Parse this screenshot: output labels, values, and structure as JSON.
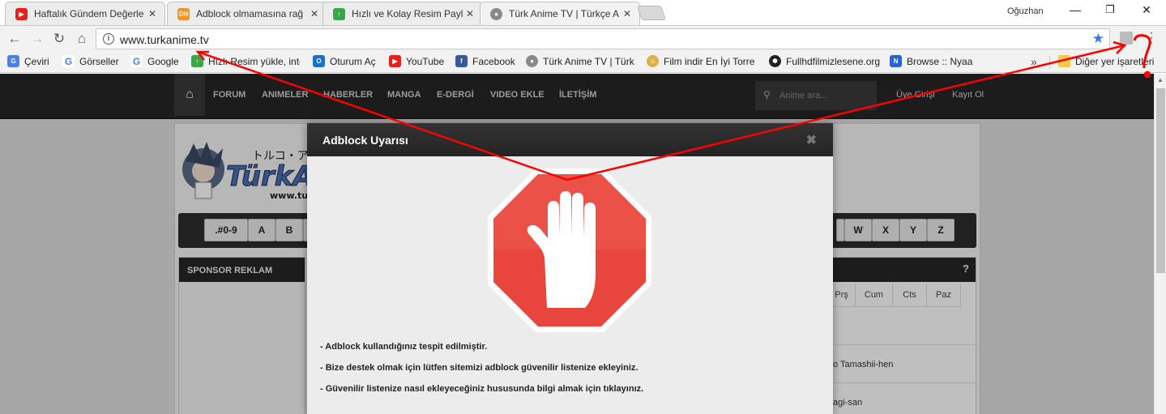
{
  "browser": {
    "tabs": [
      {
        "title": "Haftalık Gündem Değerle",
        "icon": "youtube-icon",
        "color": "#e62117"
      },
      {
        "title": "Adblock olmamasına rağ",
        "icon": "dh-icon",
        "color": "#f3922b"
      },
      {
        "title": "Hızlı ve Kolay Resim Payl",
        "icon": "upload-arrow-icon",
        "color": "#3aa648"
      },
      {
        "title": "Türk Anime TV | Türkçe A",
        "icon": "turkanime-icon",
        "color": "#7a7a7a"
      }
    ],
    "profile": "Oğuzhan",
    "url": "www.turkanime.tv",
    "bookmarks": [
      {
        "label": "Çeviri",
        "icon": "translate-icon"
      },
      {
        "label": "Görseller",
        "icon": "google-icon"
      },
      {
        "label": "Google",
        "icon": "google-icon"
      },
      {
        "label": "Hızlı Resim yükle, inte",
        "icon": "upload-arrow-icon"
      },
      {
        "label": "Oturum Aç",
        "icon": "outlook-icon"
      },
      {
        "label": "YouTube",
        "icon": "youtube-icon"
      },
      {
        "label": "Facebook",
        "icon": "facebook-icon"
      },
      {
        "label": "Türk Anime TV | Türk",
        "icon": "turkanime-icon"
      },
      {
        "label": "Film indir En İyi Torre",
        "icon": "film-icon"
      },
      {
        "label": "Fullhdfilmizlesene.org",
        "icon": "reel-icon"
      },
      {
        "label": "Browse :: Nyaa",
        "icon": "nyaa-icon"
      }
    ],
    "bookmarks_more": "»",
    "other_bookmarks": "Diğer yer işaretleri"
  },
  "site": {
    "nav": [
      "FORUM",
      "ANIMELER",
      "HABERLER",
      "MANGA",
      "E-DERGİ",
      "VIDEO EKLE",
      "İLETİŞİM"
    ],
    "search_placeholder": "Anime ara...",
    "login": "Üye Girişi",
    "register": "Kayıt Ol",
    "logo_jp": "トルコ・アニ",
    "logo_text": "TürkAn",
    "logo_url": "www.tur",
    "alpha_left": [
      ".#0-9",
      "A",
      "B"
    ],
    "alpha_right": [
      "W",
      "X",
      "Y",
      "Z"
    ],
    "sponsor_title": "SPONSOR REKLAM",
    "help": "?",
    "days": [
      "Prş",
      "Cum",
      "Cts",
      "Paz"
    ],
    "schedule": [
      "o Tamashii-hen",
      "agi-san"
    ]
  },
  "modal": {
    "title": "Adblock Uyarısı",
    "close": "✖",
    "lines": [
      "- Adblock kullandığınız tespit edilmiştir.",
      "- Bize destek olmak için lütfen sitemizi adblock güvenilir listenize ekleyiniz.",
      "- Güvenilir listenize nasıl ekleyeceğiniz hususunda bilgi almak için tıklayınız."
    ]
  },
  "colors": {
    "stop_red": "#e8453c",
    "annotation_red": "#ff0000",
    "star_blue": "#3b78e7"
  }
}
